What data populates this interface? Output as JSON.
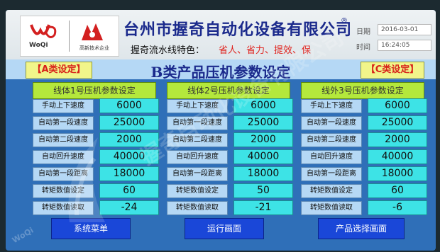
{
  "header": {
    "logo_brand": "WoQi",
    "logo_badge_text": "高新技术企业",
    "company": "台州市握奇自动化设备有限公司",
    "reg_mark": "®",
    "slogan_prefix": "握奇流水线特色：",
    "slogan_text": "省人、省力、提效、保",
    "date_label": "日期",
    "date_value": "2016-03-01",
    "time_label": "时间",
    "time_value": "16:24:05"
  },
  "nav": {
    "prev": "【A类设定】",
    "title": "B类产品压机参数设定",
    "next": "【C类设定】"
  },
  "columns": [
    {
      "header": "线体1号压机参数设定",
      "params": [
        {
          "label": "手动上下速度",
          "value": "6000"
        },
        {
          "label": "自动第一段速度",
          "value": "25000"
        },
        {
          "label": "自动第二段速度",
          "value": "2000"
        },
        {
          "label": "自动回升速度",
          "value": "40000"
        },
        {
          "label": "自动第一段距离",
          "value": "18000"
        },
        {
          "label": "转矩数值设定",
          "value": "60"
        },
        {
          "label": "转矩数值读取",
          "value": "-24"
        }
      ]
    },
    {
      "header": "线体2号压机参数设定",
      "params": [
        {
          "label": "手动上下速度",
          "value": "6000"
        },
        {
          "label": "自动第一段速度",
          "value": "25000"
        },
        {
          "label": "自动第二段速度",
          "value": "2000"
        },
        {
          "label": "自动回升速度",
          "value": "40000"
        },
        {
          "label": "自动第一段距离",
          "value": "18000"
        },
        {
          "label": "转矩数值设定",
          "value": "50"
        },
        {
          "label": "转矩数值读取",
          "value": "-21"
        }
      ]
    },
    {
      "header": "线外3号压机参数设定",
      "params": [
        {
          "label": "手动上下速度",
          "value": "6000"
        },
        {
          "label": "自动第一段速度",
          "value": "25000"
        },
        {
          "label": "自动第二段速度",
          "value": "2000"
        },
        {
          "label": "自动回升速度",
          "value": "40000"
        },
        {
          "label": "自动第一段距离",
          "value": "18000"
        },
        {
          "label": "转矩数值设定",
          "value": "60"
        },
        {
          "label": "转矩数值读取",
          "value": "-6"
        }
      ]
    }
  ],
  "buttons": {
    "system_menu": "系统菜单",
    "run_screen": "运行画面",
    "product_select": "产品选择画面"
  },
  "watermark": {
    "text": "握奇自动化设备有限公司",
    "brand": "WoQi"
  },
  "colors": {
    "title_blue": "#1b2a8c",
    "slogan_red": "#e0211c",
    "value_cyan": "#3de3e6",
    "header_green": "#b4e83c",
    "button_blue": "#1a47d8",
    "nav_yellow": "#f1f58a"
  }
}
